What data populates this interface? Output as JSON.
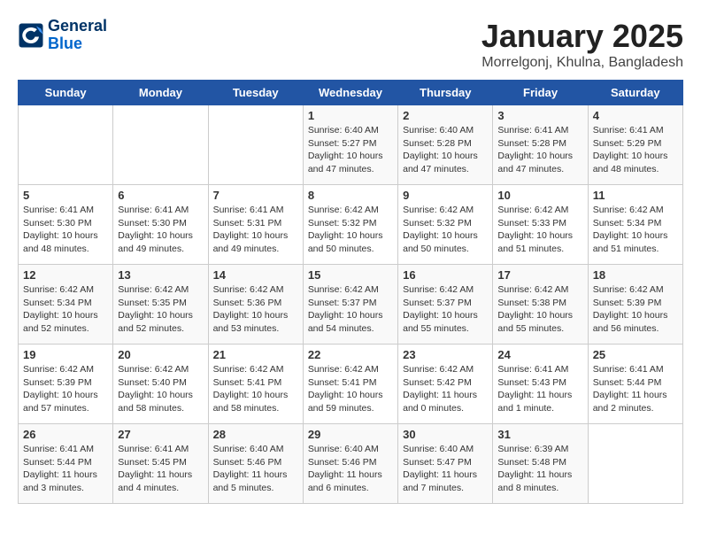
{
  "header": {
    "logo_line1": "General",
    "logo_line2": "Blue",
    "title": "January 2025",
    "subtitle": "Morrelgonj, Khulna, Bangladesh"
  },
  "days_of_week": [
    "Sunday",
    "Monday",
    "Tuesday",
    "Wednesday",
    "Thursday",
    "Friday",
    "Saturday"
  ],
  "weeks": [
    [
      {
        "day": "",
        "info": ""
      },
      {
        "day": "",
        "info": ""
      },
      {
        "day": "",
        "info": ""
      },
      {
        "day": "1",
        "info": "Sunrise: 6:40 AM\nSunset: 5:27 PM\nDaylight: 10 hours\nand 47 minutes."
      },
      {
        "day": "2",
        "info": "Sunrise: 6:40 AM\nSunset: 5:28 PM\nDaylight: 10 hours\nand 47 minutes."
      },
      {
        "day": "3",
        "info": "Sunrise: 6:41 AM\nSunset: 5:28 PM\nDaylight: 10 hours\nand 47 minutes."
      },
      {
        "day": "4",
        "info": "Sunrise: 6:41 AM\nSunset: 5:29 PM\nDaylight: 10 hours\nand 48 minutes."
      }
    ],
    [
      {
        "day": "5",
        "info": "Sunrise: 6:41 AM\nSunset: 5:30 PM\nDaylight: 10 hours\nand 48 minutes."
      },
      {
        "day": "6",
        "info": "Sunrise: 6:41 AM\nSunset: 5:30 PM\nDaylight: 10 hours\nand 49 minutes."
      },
      {
        "day": "7",
        "info": "Sunrise: 6:41 AM\nSunset: 5:31 PM\nDaylight: 10 hours\nand 49 minutes."
      },
      {
        "day": "8",
        "info": "Sunrise: 6:42 AM\nSunset: 5:32 PM\nDaylight: 10 hours\nand 50 minutes."
      },
      {
        "day": "9",
        "info": "Sunrise: 6:42 AM\nSunset: 5:32 PM\nDaylight: 10 hours\nand 50 minutes."
      },
      {
        "day": "10",
        "info": "Sunrise: 6:42 AM\nSunset: 5:33 PM\nDaylight: 10 hours\nand 51 minutes."
      },
      {
        "day": "11",
        "info": "Sunrise: 6:42 AM\nSunset: 5:34 PM\nDaylight: 10 hours\nand 51 minutes."
      }
    ],
    [
      {
        "day": "12",
        "info": "Sunrise: 6:42 AM\nSunset: 5:34 PM\nDaylight: 10 hours\nand 52 minutes."
      },
      {
        "day": "13",
        "info": "Sunrise: 6:42 AM\nSunset: 5:35 PM\nDaylight: 10 hours\nand 52 minutes."
      },
      {
        "day": "14",
        "info": "Sunrise: 6:42 AM\nSunset: 5:36 PM\nDaylight: 10 hours\nand 53 minutes."
      },
      {
        "day": "15",
        "info": "Sunrise: 6:42 AM\nSunset: 5:37 PM\nDaylight: 10 hours\nand 54 minutes."
      },
      {
        "day": "16",
        "info": "Sunrise: 6:42 AM\nSunset: 5:37 PM\nDaylight: 10 hours\nand 55 minutes."
      },
      {
        "day": "17",
        "info": "Sunrise: 6:42 AM\nSunset: 5:38 PM\nDaylight: 10 hours\nand 55 minutes."
      },
      {
        "day": "18",
        "info": "Sunrise: 6:42 AM\nSunset: 5:39 PM\nDaylight: 10 hours\nand 56 minutes."
      }
    ],
    [
      {
        "day": "19",
        "info": "Sunrise: 6:42 AM\nSunset: 5:39 PM\nDaylight: 10 hours\nand 57 minutes."
      },
      {
        "day": "20",
        "info": "Sunrise: 6:42 AM\nSunset: 5:40 PM\nDaylight: 10 hours\nand 58 minutes."
      },
      {
        "day": "21",
        "info": "Sunrise: 6:42 AM\nSunset: 5:41 PM\nDaylight: 10 hours\nand 58 minutes."
      },
      {
        "day": "22",
        "info": "Sunrise: 6:42 AM\nSunset: 5:41 PM\nDaylight: 10 hours\nand 59 minutes."
      },
      {
        "day": "23",
        "info": "Sunrise: 6:42 AM\nSunset: 5:42 PM\nDaylight: 11 hours\nand 0 minutes."
      },
      {
        "day": "24",
        "info": "Sunrise: 6:41 AM\nSunset: 5:43 PM\nDaylight: 11 hours\nand 1 minute."
      },
      {
        "day": "25",
        "info": "Sunrise: 6:41 AM\nSunset: 5:44 PM\nDaylight: 11 hours\nand 2 minutes."
      }
    ],
    [
      {
        "day": "26",
        "info": "Sunrise: 6:41 AM\nSunset: 5:44 PM\nDaylight: 11 hours\nand 3 minutes."
      },
      {
        "day": "27",
        "info": "Sunrise: 6:41 AM\nSunset: 5:45 PM\nDaylight: 11 hours\nand 4 minutes."
      },
      {
        "day": "28",
        "info": "Sunrise: 6:40 AM\nSunset: 5:46 PM\nDaylight: 11 hours\nand 5 minutes."
      },
      {
        "day": "29",
        "info": "Sunrise: 6:40 AM\nSunset: 5:46 PM\nDaylight: 11 hours\nand 6 minutes."
      },
      {
        "day": "30",
        "info": "Sunrise: 6:40 AM\nSunset: 5:47 PM\nDaylight: 11 hours\nand 7 minutes."
      },
      {
        "day": "31",
        "info": "Sunrise: 6:39 AM\nSunset: 5:48 PM\nDaylight: 11 hours\nand 8 minutes."
      },
      {
        "day": "",
        "info": ""
      }
    ]
  ]
}
